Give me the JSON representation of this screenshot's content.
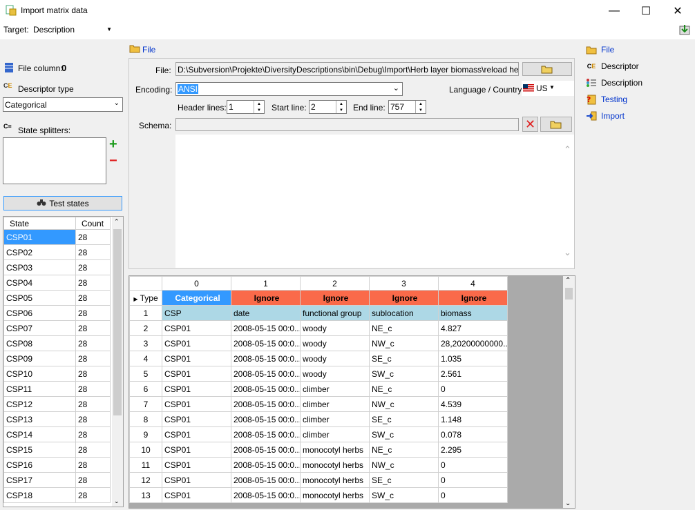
{
  "window": {
    "title": "Import matrix data",
    "minimize": "—",
    "maximize": "☐",
    "close": "✕"
  },
  "target": {
    "label": "Target:",
    "value": "Description"
  },
  "left": {
    "file_column_label": "File column:",
    "file_column_value": "0",
    "descriptor_type_label": "Descriptor type",
    "descriptor_type_value": "Categorical",
    "state_splitters_label": "State splitters:",
    "test_states_label": "Test states",
    "grid": {
      "headers": [
        "State",
        "Count"
      ],
      "rows": [
        [
          "CSP01",
          "28"
        ],
        [
          "CSP02",
          "28"
        ],
        [
          "CSP03",
          "28"
        ],
        [
          "CSP04",
          "28"
        ],
        [
          "CSP05",
          "28"
        ],
        [
          "CSP06",
          "28"
        ],
        [
          "CSP07",
          "28"
        ],
        [
          "CSP08",
          "28"
        ],
        [
          "CSP09",
          "28"
        ],
        [
          "CSP10",
          "28"
        ],
        [
          "CSP11",
          "28"
        ],
        [
          "CSP12",
          "28"
        ],
        [
          "CSP13",
          "28"
        ],
        [
          "CSP14",
          "28"
        ],
        [
          "CSP15",
          "28"
        ],
        [
          "CSP16",
          "28"
        ],
        [
          "CSP17",
          "28"
        ],
        [
          "CSP18",
          "28"
        ]
      ]
    }
  },
  "filepanel": {
    "header": "File",
    "file_label": "File:",
    "file_value": "D:\\Subversion\\Projekte\\DiversityDescriptions\\bin\\Debug\\Import\\Herb layer biomass\\reload herb layer b",
    "encoding_label": "Encoding:",
    "encoding_value": "ANSI",
    "language_label": "Language / Country:",
    "language_value": "US",
    "header_lines_label": "Header lines:",
    "header_lines_value": "1",
    "start_line_label": "Start line:",
    "start_line_value": "2",
    "end_line_label": "End line:",
    "end_line_value": "757",
    "schema_label": "Schema:"
  },
  "datagrid": {
    "col_numbers": [
      "0",
      "1",
      "2",
      "3",
      "4"
    ],
    "type_label": "Type",
    "types": [
      "Categorical",
      "Ignore",
      "Ignore",
      "Ignore",
      "Ignore"
    ],
    "rows": [
      [
        "1",
        "CSP",
        "date",
        "functional group",
        "sublocation",
        "biomass"
      ],
      [
        "2",
        "CSP01",
        "2008-05-15 00:0...",
        "woody",
        "NE_c",
        "4.827"
      ],
      [
        "3",
        "CSP01",
        "2008-05-15 00:0...",
        "woody",
        "NW_c",
        "28,20200000000..."
      ],
      [
        "4",
        "CSP01",
        "2008-05-15 00:0...",
        "woody",
        "SE_c",
        "1.035"
      ],
      [
        "5",
        "CSP01",
        "2008-05-15 00:0...",
        "woody",
        "SW_c",
        "2.561"
      ],
      [
        "6",
        "CSP01",
        "2008-05-15 00:0...",
        "climber",
        "NE_c",
        "0"
      ],
      [
        "7",
        "CSP01",
        "2008-05-15 00:0...",
        "climber",
        "NW_c",
        "4.539"
      ],
      [
        "8",
        "CSP01",
        "2008-05-15 00:0...",
        "climber",
        "SE_c",
        "1.148"
      ],
      [
        "9",
        "CSP01",
        "2008-05-15 00:0...",
        "climber",
        "SW_c",
        "0.078"
      ],
      [
        "10",
        "CSP01",
        "2008-05-15 00:0...",
        "monocotyl herbs",
        "NE_c",
        "2.295"
      ],
      [
        "11",
        "CSP01",
        "2008-05-15 00:0...",
        "monocotyl herbs",
        "NW_c",
        "0"
      ],
      [
        "12",
        "CSP01",
        "2008-05-15 00:0...",
        "monocotyl herbs",
        "SE_c",
        "0"
      ],
      [
        "13",
        "CSP01",
        "2008-05-15 00:0...",
        "monocotyl herbs",
        "SW_c",
        "0"
      ]
    ]
  },
  "nav": {
    "items": [
      {
        "label": "File",
        "icon": "folder-icon"
      },
      {
        "label": "Descriptor",
        "icon": "descriptor-icon"
      },
      {
        "label": "Description",
        "icon": "description-icon"
      },
      {
        "label": "Testing",
        "icon": "testing-icon"
      },
      {
        "label": "Import",
        "icon": "import-icon"
      }
    ]
  },
  "colors": {
    "categorical": "#3399ff",
    "ignore": "#fa6a4a",
    "header_row": "#add8e6",
    "selection": "#3399ff"
  }
}
